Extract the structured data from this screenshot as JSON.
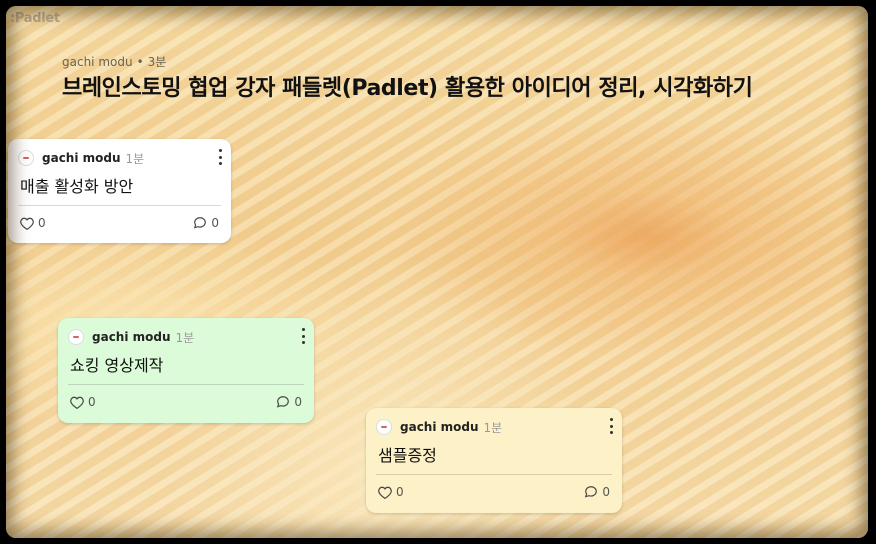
{
  "app": {
    "logo": ":Padlet"
  },
  "header": {
    "author": "gachi modu",
    "separator": "•",
    "time": "3분",
    "title": "브레인스토밍 협업 강자 패들렛(Padlet) 활용한 아이디어 정리, 시각화하기"
  },
  "posts": [
    {
      "author": "gachi modu",
      "time": "1분",
      "content": "매출 활성화 방안",
      "likes": "0",
      "comments": "0",
      "color": "#ffffff"
    },
    {
      "author": "gachi modu",
      "time": "1분",
      "content": "쇼킹 영상제작",
      "likes": "0",
      "comments": "0",
      "color": "#dcfbd9"
    },
    {
      "author": "gachi modu",
      "time": "1분",
      "content": "샘플증정",
      "likes": "0",
      "comments": "0",
      "color": "#fdf1c8"
    }
  ]
}
